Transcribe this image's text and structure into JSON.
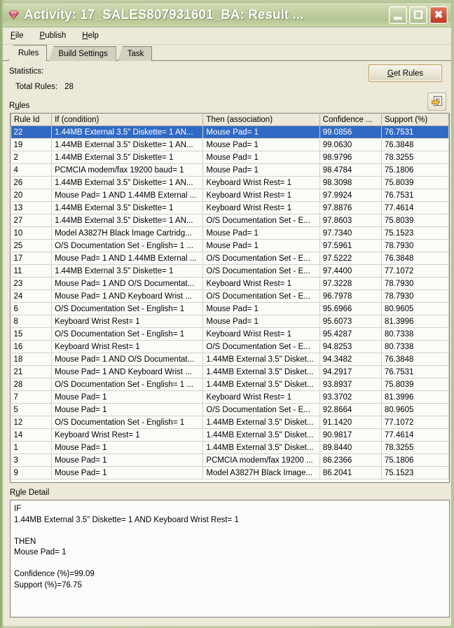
{
  "window": {
    "title": "Activity: 17_SALES807931601_BA: Result ...",
    "icon": "gem-icon",
    "frame_color": "#b7c79c",
    "titlebar_color": "#c3d0a2",
    "close_color": "#d1543a",
    "buttons": {
      "minimize": "minimize-button",
      "maximize": "maximize-button",
      "close": "close-button"
    }
  },
  "menubar": {
    "items": [
      {
        "label": "File",
        "mnemonic": "F"
      },
      {
        "label": "Publish",
        "mnemonic": "P"
      },
      {
        "label": "Help",
        "mnemonic": "H"
      }
    ]
  },
  "tabs": [
    {
      "label": "Rules",
      "active": true
    },
    {
      "label": "Build Settings",
      "active": false
    },
    {
      "label": "Task",
      "active": false
    }
  ],
  "panel": {
    "statistics_label": "Statistics:",
    "total_rules_label": "Total Rules:",
    "total_rules_value": "28",
    "rules_label": "Rules",
    "get_rules_button": "Get Rules",
    "get_rules_mnemonic": "G",
    "export_button_icon": "export-arrow-icon",
    "selection_color": "#316ac5"
  },
  "table": {
    "columns": [
      "Rule Id",
      "If (condition)",
      "Then (association)",
      "Confidence ...",
      "Support (%)"
    ],
    "selected_row_index": 0,
    "rows": [
      {
        "rule_id": "22",
        "if": "1.44MB External 3.5\" Diskette= 1 AN...",
        "then": "Mouse Pad= 1",
        "confidence": "99.0856",
        "support": "76.7531"
      },
      {
        "rule_id": "19",
        "if": "1.44MB External 3.5\" Diskette= 1 AN...",
        "then": "Mouse Pad= 1",
        "confidence": "99.0630",
        "support": "76.3848"
      },
      {
        "rule_id": "2",
        "if": "1.44MB External 3.5\" Diskette= 1",
        "then": "Mouse Pad= 1",
        "confidence": "98.9796",
        "support": "78.3255"
      },
      {
        "rule_id": "4",
        "if": "PCMCIA modem/fax 19200 baud= 1",
        "then": "Mouse Pad= 1",
        "confidence": "98.4784",
        "support": "75.1806"
      },
      {
        "rule_id": "26",
        "if": "1.44MB External 3.5\" Diskette= 1 AN...",
        "then": "Keyboard Wrist Rest= 1",
        "confidence": "98.3098",
        "support": "75.8039"
      },
      {
        "rule_id": "20",
        "if": "Mouse Pad= 1 AND 1.44MB External ...",
        "then": "Keyboard Wrist Rest= 1",
        "confidence": "97.9924",
        "support": "76.7531"
      },
      {
        "rule_id": "13",
        "if": "1.44MB External 3.5\" Diskette= 1",
        "then": "Keyboard Wrist Rest= 1",
        "confidence": "97.8876",
        "support": "77.4614"
      },
      {
        "rule_id": "27",
        "if": "1.44MB External 3.5\" Diskette= 1 AN...",
        "then": "O/S Documentation Set - E...",
        "confidence": "97.8603",
        "support": "75.8039"
      },
      {
        "rule_id": "10",
        "if": "Model A3827H Black Image Cartridg...",
        "then": "Mouse Pad= 1",
        "confidence": "97.7340",
        "support": "75.1523"
      },
      {
        "rule_id": "25",
        "if": "O/S Documentation Set - English= 1 ...",
        "then": "Mouse Pad= 1",
        "confidence": "97.5961",
        "support": "78.7930"
      },
      {
        "rule_id": "17",
        "if": "Mouse Pad= 1 AND 1.44MB External ...",
        "then": "O/S Documentation Set - E...",
        "confidence": "97.5222",
        "support": "76.3848"
      },
      {
        "rule_id": "11",
        "if": "1.44MB External 3.5\" Diskette= 1",
        "then": "O/S Documentation Set - E...",
        "confidence": "97.4400",
        "support": "77.1072"
      },
      {
        "rule_id": "23",
        "if": "Mouse Pad= 1 AND O/S Documentat...",
        "then": "Keyboard Wrist Rest= 1",
        "confidence": "97.3228",
        "support": "78.7930"
      },
      {
        "rule_id": "24",
        "if": "Mouse Pad= 1 AND Keyboard Wrist ...",
        "then": "O/S Documentation Set - E...",
        "confidence": "96.7978",
        "support": "78.7930"
      },
      {
        "rule_id": "6",
        "if": "O/S Documentation Set - English= 1",
        "then": "Mouse Pad= 1",
        "confidence": "95.6966",
        "support": "80.9605"
      },
      {
        "rule_id": "8",
        "if": "Keyboard Wrist Rest= 1",
        "then": "Mouse Pad= 1",
        "confidence": "95.6073",
        "support": "81.3996"
      },
      {
        "rule_id": "15",
        "if": "O/S Documentation Set - English= 1",
        "then": "Keyboard Wrist Rest= 1",
        "confidence": "95.4287",
        "support": "80.7338"
      },
      {
        "rule_id": "16",
        "if": "Keyboard Wrist Rest= 1",
        "then": "O/S Documentation Set - E...",
        "confidence": "94.8253",
        "support": "80.7338"
      },
      {
        "rule_id": "18",
        "if": "Mouse Pad= 1 AND O/S Documentat...",
        "then": "1.44MB External 3.5\" Disket...",
        "confidence": "94.3482",
        "support": "76.3848"
      },
      {
        "rule_id": "21",
        "if": "Mouse Pad= 1 AND Keyboard Wrist ...",
        "then": "1.44MB External 3.5\" Disket...",
        "confidence": "94.2917",
        "support": "76.7531"
      },
      {
        "rule_id": "28",
        "if": "O/S Documentation Set - English= 1 ...",
        "then": "1.44MB External 3.5\" Disket...",
        "confidence": "93.8937",
        "support": "75.8039"
      },
      {
        "rule_id": "7",
        "if": "Mouse Pad= 1",
        "then": "Keyboard Wrist Rest= 1",
        "confidence": "93.3702",
        "support": "81.3996"
      },
      {
        "rule_id": "5",
        "if": "Mouse Pad= 1",
        "then": "O/S Documentation Set - E...",
        "confidence": "92.8664",
        "support": "80.9605"
      },
      {
        "rule_id": "12",
        "if": "O/S Documentation Set - English= 1",
        "then": "1.44MB External 3.5\" Disket...",
        "confidence": "91.1420",
        "support": "77.1072"
      },
      {
        "rule_id": "14",
        "if": "Keyboard Wrist Rest= 1",
        "then": "1.44MB External 3.5\" Disket...",
        "confidence": "90.9817",
        "support": "77.4614"
      },
      {
        "rule_id": "1",
        "if": "Mouse Pad= 1",
        "then": "1.44MB External 3.5\" Disket...",
        "confidence": "89.8440",
        "support": "78.3255"
      },
      {
        "rule_id": "3",
        "if": "Mouse Pad= 1",
        "then": "PCMCIA modem/fax 19200 ...",
        "confidence": "86.2366",
        "support": "75.1806"
      },
      {
        "rule_id": "9",
        "if": "Mouse Pad= 1",
        "then": "Model A3827H Black Image...",
        "confidence": "86.2041",
        "support": "75.1523"
      }
    ]
  },
  "rule_detail": {
    "label": "Rule Detail",
    "mnemonic": "u",
    "text": "IF\n1.44MB External 3.5\" Diskette= 1 AND Keyboard Wrist Rest= 1\n\nTHEN\nMouse Pad= 1\n\nConfidence (%)=99.09\nSupport (%)=76.75"
  }
}
